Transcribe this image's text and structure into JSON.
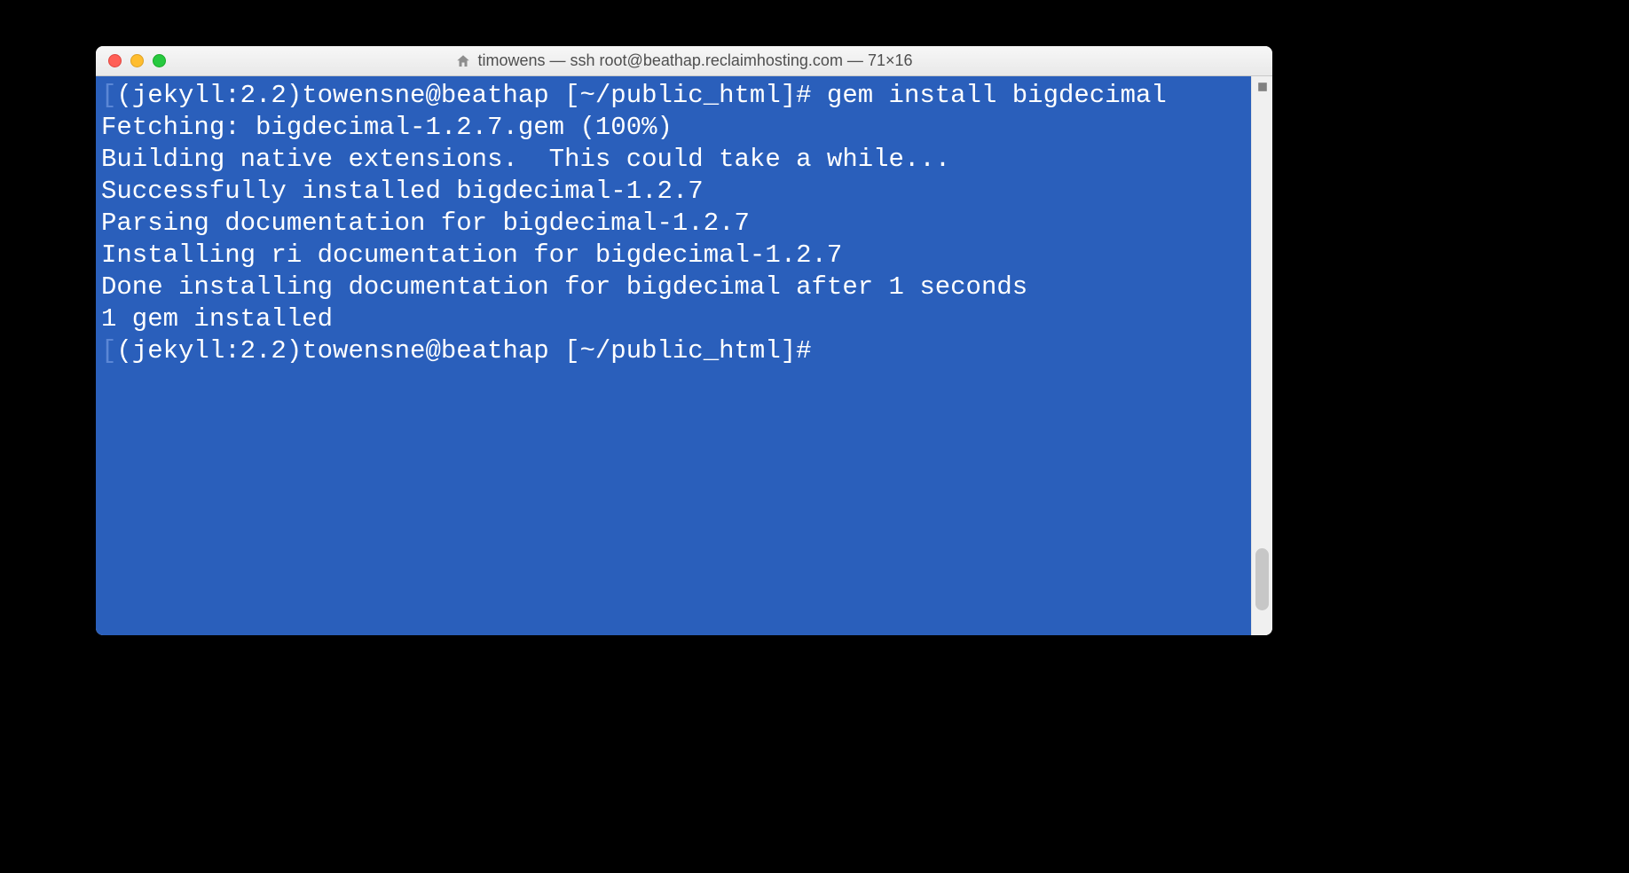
{
  "window": {
    "title": "timowens — ssh root@beathap.reclaimhosting.com — 71×16"
  },
  "terminal": {
    "lines": [
      {
        "marker": "[",
        "text": "(jekyll:2.2)towensne@beathap [~/public_html]# gem install bigdecimal"
      },
      {
        "text": "Fetching: bigdecimal-1.2.7.gem (100%)"
      },
      {
        "text": "Building native extensions.  This could take a while..."
      },
      {
        "text": "Successfully installed bigdecimal-1.2.7"
      },
      {
        "text": "Parsing documentation for bigdecimal-1.2.7"
      },
      {
        "text": "Installing ri documentation for bigdecimal-1.2.7"
      },
      {
        "text": "Done installing documentation for bigdecimal after 1 seconds"
      },
      {
        "text": "1 gem installed"
      },
      {
        "marker": "[",
        "text": "(jekyll:2.2)towensne@beathap [~/public_html]# "
      }
    ]
  },
  "colors": {
    "terminal_bg": "#2a5fbb",
    "terminal_fg": "#ffffff"
  }
}
